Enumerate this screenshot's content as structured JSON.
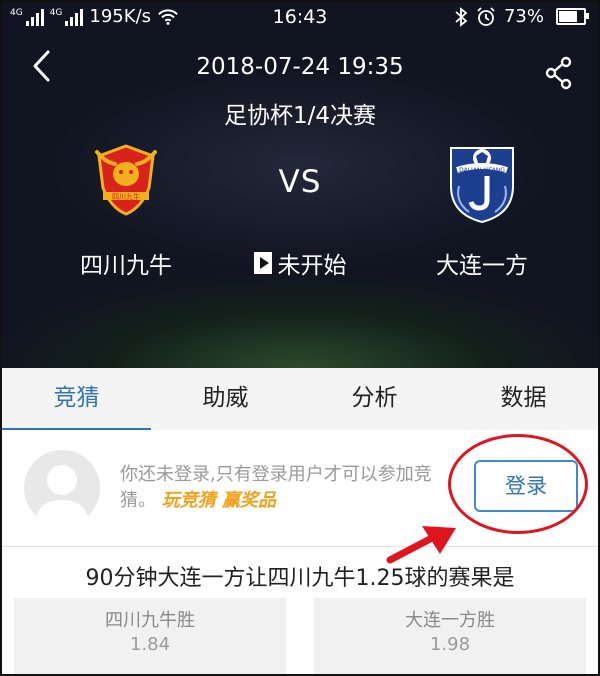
{
  "status_bar": {
    "network_speed": "195K/s",
    "time": "16:43",
    "battery": "73%",
    "signal_tag_1": "4G",
    "signal_tag_2": "4G"
  },
  "match": {
    "datetime": "2018-07-24 19:35",
    "competition": "足协杯1/4决赛",
    "home_team": "四川九牛",
    "away_team": "大连一方",
    "vs": "VS",
    "status": "未开始",
    "home_logo_text": "四川九牛",
    "away_logo_text": "DALIAN YIFANG"
  },
  "tabs": [
    {
      "label": "竞猜",
      "active": true
    },
    {
      "label": "助威",
      "active": false
    },
    {
      "label": "分析",
      "active": false
    },
    {
      "label": "数据",
      "active": false
    }
  ],
  "login": {
    "message": "你还未登录,只有登录用户才可以参加竞猜。",
    "promo": "玩竞猜 赢奖品",
    "button_label": "登录"
  },
  "bet": {
    "question": "90分钟大连一方让四川九牛1.25球的赛果是",
    "options": [
      {
        "label": "四川九牛胜",
        "odds": "1.84"
      },
      {
        "label": "大连一方胜",
        "odds": "1.98"
      }
    ]
  },
  "colors": {
    "accent": "#2f73b8",
    "promo": "#f0a21c",
    "annotation": "#e0141e"
  }
}
